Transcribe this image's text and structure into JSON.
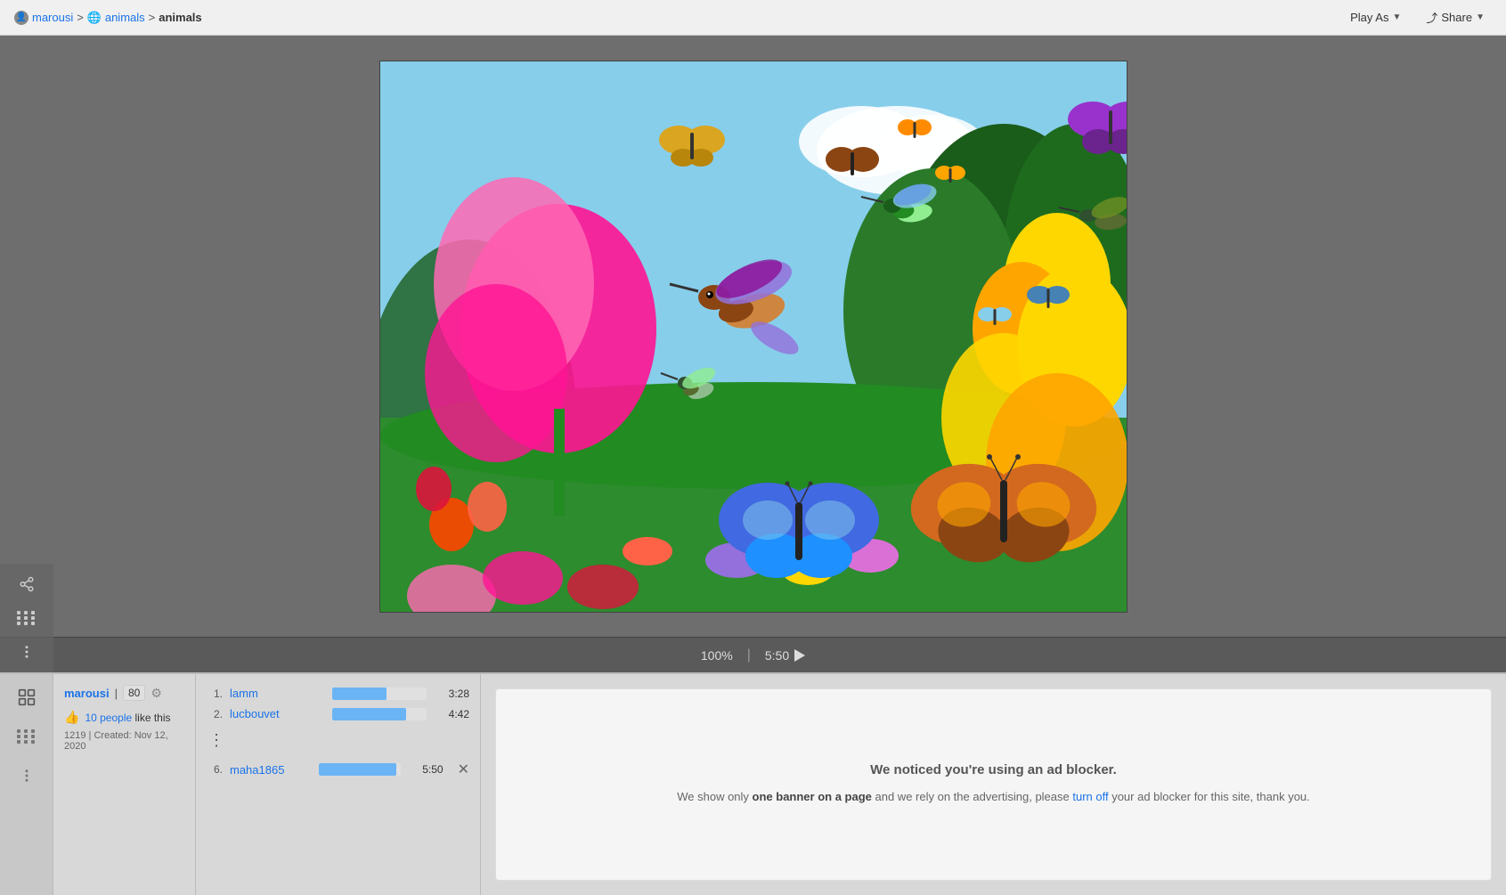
{
  "nav": {
    "user_icon": "👤",
    "username": "marousi",
    "separator1": ">",
    "globe_icon": "🌐",
    "category": "animals",
    "separator2": ">",
    "current": "animals",
    "play_as_label": "Play As",
    "share_label": "Share"
  },
  "puzzle": {
    "zoom": "100%",
    "time": "5:50",
    "alt": "Hummingbirds and butterflies in a colorful garden"
  },
  "bottom": {
    "user": {
      "name": "marousi",
      "score": "80",
      "likes_count": "10",
      "likes_label": "10 people like this",
      "created_label": "Created: Nov 12, 2020",
      "created_id": "1219"
    },
    "leaderboard": [
      {
        "rank": "1.",
        "name": "lamm",
        "time": "3:28",
        "bar_pct": 58
      },
      {
        "rank": "2.",
        "name": "lucbouvet",
        "time": "4:42",
        "bar_pct": 78
      },
      {
        "rank": "6.",
        "name": "maha1865",
        "time": "5:50",
        "bar_pct": 95
      }
    ],
    "ad_notice": {
      "title": "We noticed you're using an ad blocker.",
      "body_start": "We show only ",
      "body_bold": "one banner on a page",
      "body_mid": " and we rely on the advertising, please ",
      "body_link": "turn off",
      "body_end": " your ad blocker for this site, thank you."
    }
  },
  "icons": {
    "share": "⤴",
    "grid": "⊞",
    "more": "⋮",
    "puzzle_grid": "⊞",
    "puzzle_more": "⋮",
    "thumb": "👍",
    "gear": "⚙"
  }
}
